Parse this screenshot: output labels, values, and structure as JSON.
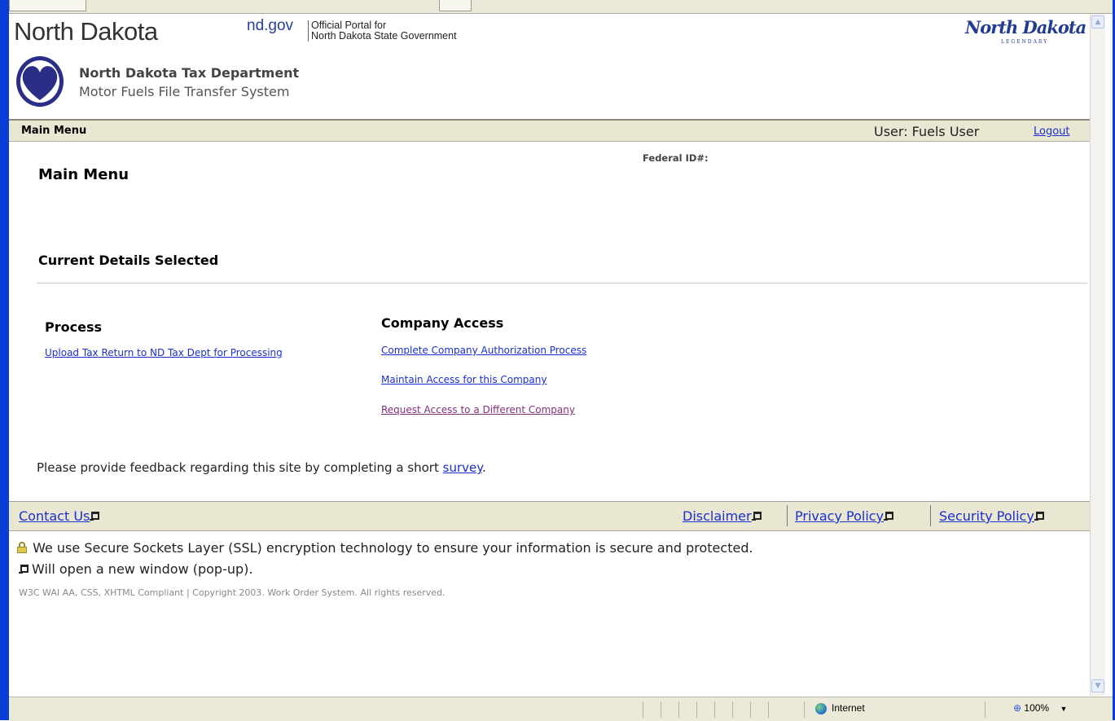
{
  "portal": {
    "state_name": "North Dakota",
    "nd_gov": "nd.gov",
    "official_portal_line1": "Official Portal for",
    "official_portal_line2": "North Dakota State Government",
    "legendary_script": "North Dakota",
    "legendary_sub": "LEGENDARY"
  },
  "department": {
    "name": "North Dakota Tax Department",
    "system": "Motor Fuels File Transfer System"
  },
  "menu_bar": {
    "breadcrumb": "Main Menu",
    "user_text": "User: Fuels User",
    "logout": "Logout"
  },
  "main": {
    "federal_id_label": "Federal ID#:",
    "title": "Main Menu",
    "current_details_heading": "Current Details Selected",
    "process": {
      "heading": "Process",
      "links": [
        "Upload Tax Return to ND Tax Dept for Processing"
      ]
    },
    "company_access": {
      "heading": "Company Access",
      "links": [
        "Complete Company Authorization Process",
        "Maintain Access for this Company",
        "Request Access to a Different Company"
      ]
    },
    "feedback_prefix": "Please provide feedback regarding this site by completing a short",
    "feedback_link": "survey",
    "feedback_suffix": "."
  },
  "footer": {
    "contact_us": "Contact Us",
    "disclaimer": "Disclaimer",
    "privacy_policy": "Privacy Policy",
    "security_policy": "Security Policy",
    "ssl_notice": "We use Secure Sockets Layer (SSL) encryption technology to ensure your information is secure and protected.",
    "popup_notice": "Will open a new window (pop-up).",
    "copyright": "W3C WAI AA, CSS, XHTML Compliant | Copyright 2003. Work Order System. All rights reserved."
  },
  "status_bar": {
    "zone": "Internet",
    "zoom": "100%"
  },
  "colors": {
    "link": "#1a2fd0",
    "visited_link": "#80307a",
    "menu_bar_bg": "#e9e6d2",
    "window_frame": "#0a3dd6"
  }
}
